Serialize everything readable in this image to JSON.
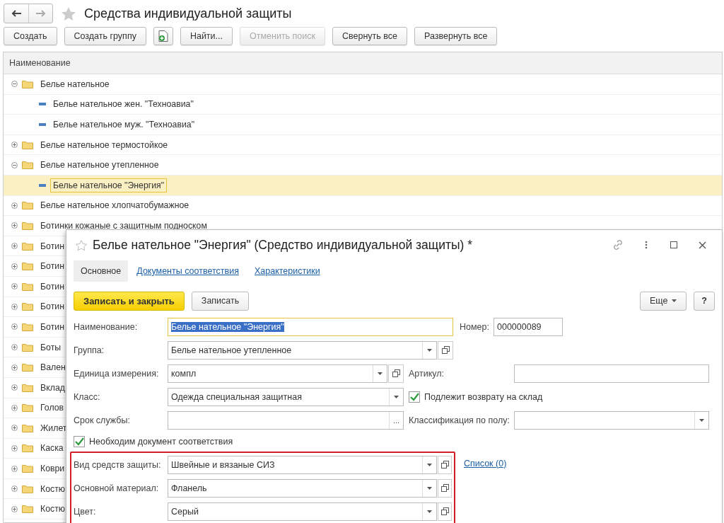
{
  "window": {
    "title": "Средства индивидуальной защиты",
    "favorite": false
  },
  "toolbar": [
    {
      "kind": "text",
      "label": "Создать",
      "disabled": false
    },
    {
      "kind": "text",
      "label": "Создать группу",
      "disabled": false
    },
    {
      "kind": "icon",
      "disabled": false
    },
    {
      "kind": "text",
      "label": "Найти...",
      "disabled": false
    },
    {
      "kind": "text",
      "label": "Отменить поиск",
      "disabled": true
    },
    {
      "kind": "text",
      "label": "Свернуть все",
      "disabled": false
    },
    {
      "kind": "text",
      "label": "Развернуть все",
      "disabled": false
    }
  ],
  "list": {
    "column": "Наименование",
    "rows": [
      {
        "label": "Белье нательное",
        "expanded": true,
        "selected": false,
        "children": [
          {
            "label": "Белье нательное жен. \"Техноавиа\"",
            "selected": false
          },
          {
            "label": "Белье нательное муж. \"Техноавиа\"",
            "selected": false
          }
        ]
      },
      {
        "label": "Белье нательное термостойкое",
        "expanded": false,
        "selected": false
      },
      {
        "label": "Белье нательное утепленное",
        "expanded": true,
        "selected": false,
        "children": [
          {
            "label": "Белье нательное \"Энергия\"",
            "selected": true
          }
        ]
      },
      {
        "label": "Белье нательное хлопчатобумажное",
        "expanded": false,
        "selected": false
      },
      {
        "label": "Ботинки кожаные с защитным подноском",
        "expanded": false,
        "selected": false
      },
      {
        "label": "Ботин",
        "expanded": false,
        "selected": false
      },
      {
        "label": "Ботин",
        "expanded": false,
        "selected": false
      },
      {
        "label": "Ботин",
        "expanded": false,
        "selected": false
      },
      {
        "label": "Ботин",
        "expanded": false,
        "selected": false
      },
      {
        "label": "Ботин",
        "expanded": false,
        "selected": false
      },
      {
        "label": "Боты",
        "expanded": false,
        "selected": false
      },
      {
        "label": "Вален",
        "expanded": false,
        "selected": false
      },
      {
        "label": "Вклад",
        "expanded": false,
        "selected": false
      },
      {
        "label": "Голов",
        "expanded": false,
        "selected": false
      },
      {
        "label": "Жилет",
        "expanded": false,
        "selected": false
      },
      {
        "label": "Каска",
        "expanded": false,
        "selected": false
      },
      {
        "label": "Коври",
        "expanded": false,
        "selected": false
      },
      {
        "label": "Костю",
        "expanded": false,
        "selected": false
      },
      {
        "label": "Костю",
        "expanded": false,
        "selected": false
      }
    ]
  },
  "dialog": {
    "title": "Белье нательное \"Энергия\" (Средство индивидуальной защиты) *",
    "tabs": [
      {
        "label": "Основное",
        "selected": true
      },
      {
        "label": "Документы соответствия",
        "selected": false
      },
      {
        "label": "Характеристики",
        "selected": false
      }
    ],
    "save_close": "Записать и закрыть",
    "save": "Записать",
    "more": "Еще",
    "help": "?",
    "name": {
      "label": "Наименование:",
      "value": "Белье нательное \"Энергия\"",
      "number_label": "Номер:",
      "number_value": "000000089"
    },
    "group": {
      "label": "Группа:",
      "value": "Белье нательное утепленное",
      "dropdown": true,
      "open": true
    },
    "unit": {
      "label": "Единица измерения:",
      "value": "компл",
      "dropdown": true,
      "open": true
    },
    "article": {
      "label": "Артикул:"
    },
    "class": {
      "label": "Класс:",
      "value": "Одежда специальная защитная",
      "dropdown": true
    },
    "return_check": {
      "label": "Подлежит возврату на склад",
      "checked": true
    },
    "service_life": {
      "label": "Срок службы:",
      "ellipsis": "..."
    },
    "gender": {
      "label": "Классификация по полу:",
      "dropdown": true
    },
    "doc_check": {
      "label": "Необходим документ соответствия",
      "checked": true
    },
    "highlighted": [
      {
        "label": "Вид средств защиты:",
        "value": "Швейные и вязаные СИЗ",
        "dropdown": true,
        "open": true
      },
      {
        "label": "Основной материал:",
        "value": "Фланель",
        "dropdown": true,
        "open": true
      },
      {
        "label": "Цвет:",
        "value": "Серый",
        "dropdown": true,
        "open": true
      }
    ],
    "list_link": "Список (0)"
  }
}
